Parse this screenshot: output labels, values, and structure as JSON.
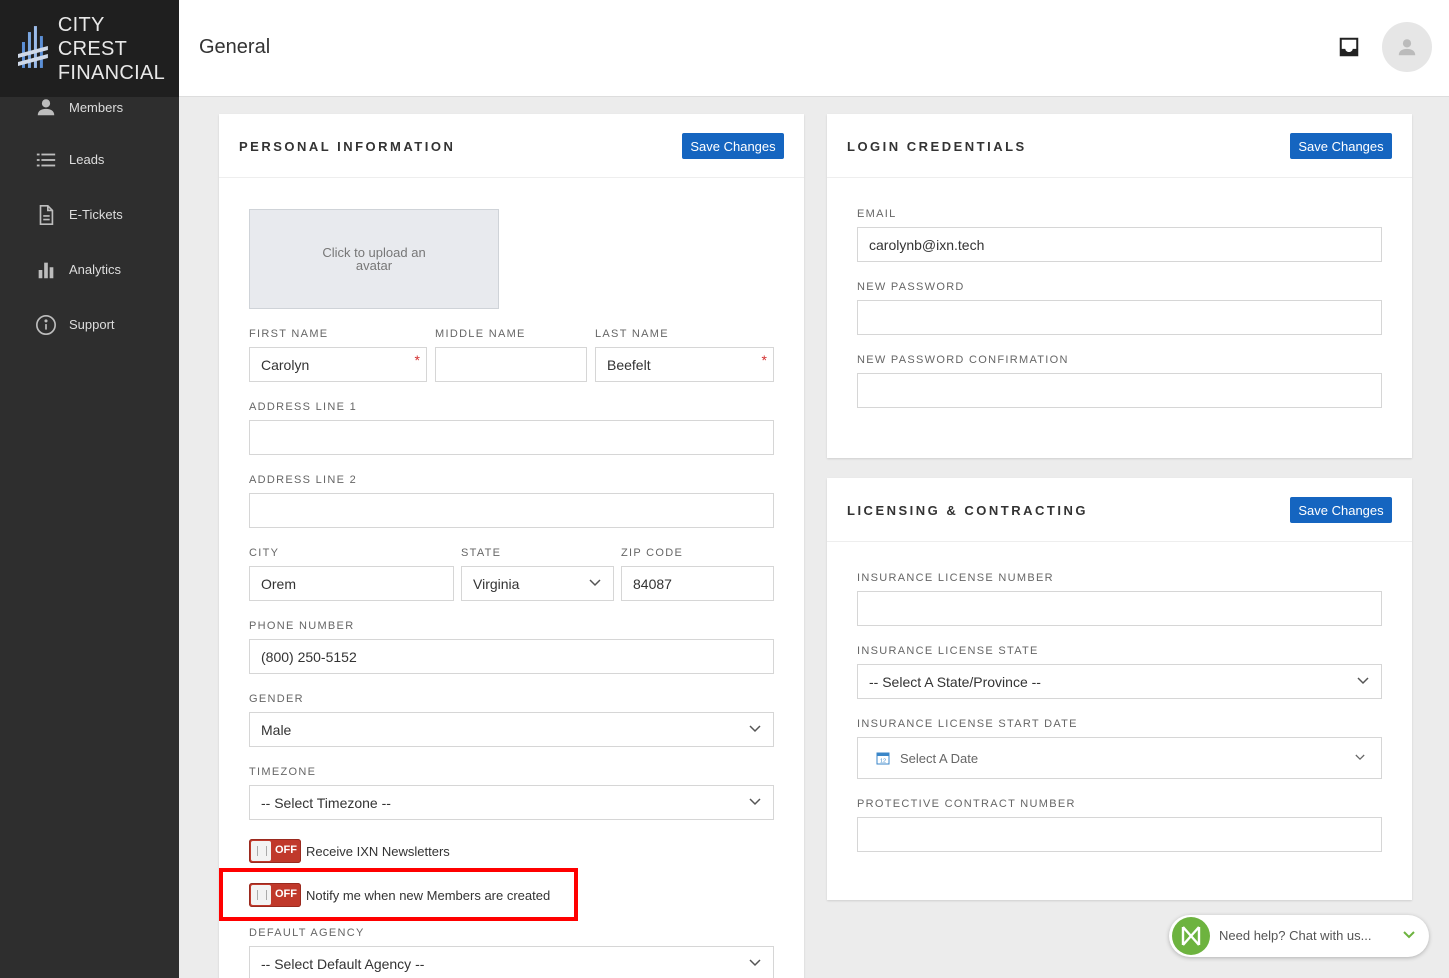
{
  "brand": {
    "line1": "CITY CREST",
    "line2": "FINANCIAL"
  },
  "sidebar": {
    "items": [
      {
        "label": "Members",
        "icon": "person-icon"
      },
      {
        "label": "Leads",
        "icon": "list-icon"
      },
      {
        "label": "E-Tickets",
        "icon": "document-icon"
      },
      {
        "label": "Analytics",
        "icon": "bar-chart-icon"
      },
      {
        "label": "Support",
        "icon": "info-icon"
      }
    ]
  },
  "header": {
    "title": "General"
  },
  "personal": {
    "title": "PERSONAL INFORMATION",
    "save_label": "Save Changes",
    "upload_text": "Click to upload an avatar",
    "first_name": {
      "label": "FIRST NAME",
      "value": "Carolyn"
    },
    "middle_name": {
      "label": "MIDDLE NAME",
      "value": ""
    },
    "last_name": {
      "label": "LAST NAME",
      "value": "Beefelt"
    },
    "address1": {
      "label": "ADDRESS LINE 1",
      "value": ""
    },
    "address2": {
      "label": "ADDRESS LINE 2",
      "value": ""
    },
    "city": {
      "label": "CITY",
      "value": "Orem"
    },
    "state": {
      "label": "STATE",
      "value": "Virginia"
    },
    "zip": {
      "label": "ZIP CODE",
      "value": "84087"
    },
    "phone": {
      "label": "PHONE NUMBER",
      "value": "(800) 250-5152"
    },
    "gender": {
      "label": "GENDER",
      "value": "Male"
    },
    "timezone": {
      "label": "TIMEZONE",
      "value": "-- Select Timezone --"
    },
    "newsletter": {
      "state": "OFF",
      "label": "Receive IXN Newsletters"
    },
    "notify": {
      "state": "OFF",
      "label": "Notify me when new Members are created"
    },
    "agency": {
      "label": "DEFAULT AGENCY",
      "value": "-- Select Default Agency --"
    }
  },
  "login": {
    "title": "LOGIN CREDENTIALS",
    "save_label": "Save Changes",
    "email": {
      "label": "EMAIL",
      "value": "carolynb@ixn.tech"
    },
    "new_password": {
      "label": "NEW PASSWORD",
      "value": ""
    },
    "confirm_password": {
      "label": "NEW PASSWORD CONFIRMATION",
      "value": ""
    }
  },
  "licensing": {
    "title": "LICENSING & CONTRACTING",
    "save_label": "Save Changes",
    "license_number": {
      "label": "INSURANCE LICENSE NUMBER",
      "value": ""
    },
    "license_state": {
      "label": "INSURANCE LICENSE STATE",
      "value": "-- Select A State/Province --"
    },
    "license_start": {
      "label": "INSURANCE LICENSE START DATE",
      "value": "Select A Date"
    },
    "contract_number": {
      "label": "PROTECTIVE CONTRACT NUMBER",
      "value": ""
    }
  },
  "chat": {
    "text": "Need help? Chat with us..."
  },
  "colors": {
    "primary": "#1565c0",
    "toggle_off": "#c0392b",
    "highlight": "#ff0000",
    "chat_green": "#6db33f",
    "sidebar": "#2e2e2e"
  }
}
